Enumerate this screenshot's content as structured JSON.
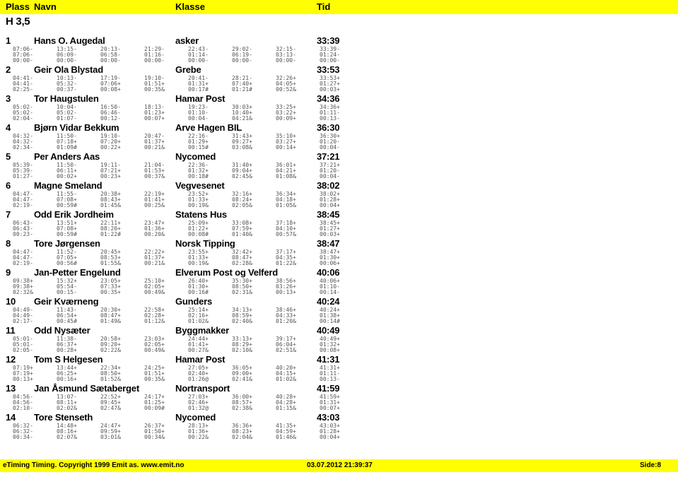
{
  "header": {
    "plass": "Plass",
    "navn": "Navn",
    "klasse": "Klasse",
    "tid": "Tid"
  },
  "class_title": "H 3,5",
  "results": [
    {
      "plass": "1",
      "navn": "Hans O. Augedal",
      "klasse": "asker",
      "tid": "33:39",
      "cumulative": [
        "07:06-",
        "13:15-",
        "20:13-",
        "21:29-",
        "22:43-",
        "29:02-",
        "32:15-",
        "33:39-"
      ],
      "legs": [
        "07:06-",
        "06:09-",
        "06:58-",
        "01:16-",
        "01:14-",
        "06:19-",
        "03:13-",
        "01:24-"
      ],
      "diffs": [
        "00:00-",
        "00:00-",
        "00:00-",
        "00:00-",
        "00:00-",
        "00:00-",
        "00:00-",
        "00:00-"
      ]
    },
    {
      "plass": "2",
      "navn": "Geir Ola Blystad",
      "klasse": "Grebe",
      "tid": "33:53",
      "cumulative": [
        "04:41-",
        "10:13-",
        "17:19-",
        "19:10-",
        "20:41-",
        "28:21-",
        "32:26+",
        "33:53+"
      ],
      "legs": [
        "04:41-",
        "05:32-",
        "07:06+",
        "01:51+",
        "01:31+",
        "07:40+",
        "04:05+",
        "01:27+"
      ],
      "diffs": [
        "02:25-",
        "00:37-",
        "00:08+",
        "00:35&",
        "00:17#",
        "01:21#",
        "00:52&",
        "00:03+"
      ]
    },
    {
      "plass": "3",
      "navn": "Tor Haugstulen",
      "klasse": "Hamar Post",
      "tid": "34:36",
      "cumulative": [
        "05:02-",
        "10:04-",
        "16:50-",
        "18:13-",
        "19:23-",
        "30:03+",
        "33:25+",
        "34:36+"
      ],
      "legs": [
        "05:02-",
        "05:02-",
        "06:46-",
        "01:23+",
        "01:10-",
        "10:40+",
        "03:22+",
        "01:11-"
      ],
      "diffs": [
        "02:04-",
        "01:07-",
        "00:12-",
        "00:07+",
        "00:04-",
        "04:21&",
        "00:09+",
        "00:13-"
      ]
    },
    {
      "plass": "4",
      "navn": "Bjørn Vidar Bekkum",
      "klasse": "Arve Hagen BIL",
      "tid": "36:30",
      "cumulative": [
        "04:32-",
        "11:50-",
        "19:10-",
        "20:47-",
        "22:16-",
        "31:43+",
        "35:10+",
        "36:30+"
      ],
      "legs": [
        "04:32-",
        "07:18+",
        "07:20+",
        "01:37+",
        "01:29+",
        "09:27+",
        "03:27+",
        "01:20-"
      ],
      "diffs": [
        "02:34-",
        "01:09#",
        "00:22+",
        "00:21&",
        "00:15#",
        "03:08&",
        "00:14+",
        "00:04-"
      ]
    },
    {
      "plass": "5",
      "navn": "Per Anders Aas",
      "klasse": "Nycomed",
      "tid": "37:21",
      "cumulative": [
        "05:39-",
        "11:50-",
        "19:11-",
        "21:04-",
        "22:36-",
        "31:40+",
        "36:01+",
        "37:21+"
      ],
      "legs": [
        "05:39-",
        "06:11+",
        "07:21+",
        "01:53+",
        "01:32+",
        "09:04+",
        "04:21+",
        "01:20-"
      ],
      "diffs": [
        "01:27-",
        "00:02+",
        "00:23+",
        "00:37&",
        "00:18#",
        "02:45&",
        "01:08&",
        "00:04-"
      ]
    },
    {
      "plass": "6",
      "navn": "Magne Smeland",
      "klasse": "Vegvesenet",
      "tid": "38:02",
      "cumulative": [
        "04:47-",
        "11:55-",
        "20:38+",
        "22:19+",
        "23:52+",
        "32:16+",
        "36:34+",
        "38:02+"
      ],
      "legs": [
        "04:47-",
        "07:08+",
        "08:43+",
        "01:41+",
        "01:33+",
        "08:24+",
        "04:18+",
        "01:28+"
      ],
      "diffs": [
        "02:19-",
        "00:59#",
        "01:45&",
        "00:25&",
        "00:19&",
        "02:05&",
        "01:05&",
        "00:04+"
      ]
    },
    {
      "plass": "7",
      "navn": "Odd Erik Jordheim",
      "klasse": "Statens Hus",
      "tid": "38:45",
      "cumulative": [
        "06:43-",
        "13:51+",
        "22:11+",
        "23:47+",
        "25:09+",
        "33:08+",
        "37:18+",
        "38:45+"
      ],
      "legs": [
        "06:43-",
        "07:08+",
        "08:20+",
        "01:36+",
        "01:22+",
        "07:59+",
        "04:10+",
        "01:27+"
      ],
      "diffs": [
        "00:23-",
        "00:59#",
        "01:22#",
        "00:20&",
        "00:08#",
        "01:40&",
        "00:57&",
        "00:03+"
      ]
    },
    {
      "plass": "8",
      "navn": "Tore  Jørgensen",
      "klasse": "Norsk Tipping",
      "tid": "38:47",
      "cumulative": [
        "04:47-",
        "11:52-",
        "20:45+",
        "22:22+",
        "23:55+",
        "32:42+",
        "37:17+",
        "38:47+"
      ],
      "legs": [
        "04:47-",
        "07:05+",
        "08:53+",
        "01:37+",
        "01:33+",
        "08:47+",
        "04:35+",
        "01:30+"
      ],
      "diffs": [
        "02:19-",
        "00:56#",
        "01:55&",
        "00:21&",
        "00:19&",
        "02:28&",
        "01:22&",
        "00:06+"
      ]
    },
    {
      "plass": "9",
      "navn": "Jan-Petter Engelund",
      "klasse": "Elverum Post og Velferd",
      "tid": "40:06",
      "cumulative": [
        "09:38+",
        "15:32+",
        "23:05+",
        "25:10+",
        "26:40+",
        "35:30+",
        "38:56+",
        "40:06+"
      ],
      "legs": [
        "09:38+",
        "05:54-",
        "07:33+",
        "02:05+",
        "01:30+",
        "08:50+",
        "03:26+",
        "01:10-"
      ],
      "diffs": [
        "02:32&",
        "00:15-",
        "00:35+",
        "00:49&",
        "00:16#",
        "02:31&",
        "00:13+",
        "00:14-"
      ]
    },
    {
      "plass": "10",
      "navn": "Geir Kværneng",
      "klasse": "Gunders",
      "tid": "40:24",
      "cumulative": [
        "04:49-",
        "11:43-",
        "20:30+",
        "22:58+",
        "25:14+",
        "34:13+",
        "38:46+",
        "40:24+"
      ],
      "legs": [
        "04:49-",
        "06:54+",
        "08:47+",
        "02:28+",
        "02:16+",
        "08:59+",
        "04:33+",
        "01:38+"
      ],
      "diffs": [
        "02:17-",
        "00:45#",
        "01:49&",
        "01:12&",
        "01:02&",
        "02:40&",
        "01:20&",
        "00:14#"
      ]
    },
    {
      "plass": "11",
      "navn": "Odd Nysæter",
      "klasse": "Byggmakker",
      "tid": "40:49",
      "cumulative": [
        "05:01-",
        "11:38-",
        "20:58+",
        "23:03+",
        "24:44+",
        "33:13+",
        "39:17+",
        "40:49+"
      ],
      "legs": [
        "05:01-",
        "06:37+",
        "09:20+",
        "02:05+",
        "01:41+",
        "08:29+",
        "06:04+",
        "01:32+"
      ],
      "diffs": [
        "02:05-",
        "00:28+",
        "02:22&",
        "00:49&",
        "00:27&",
        "02:10&",
        "02:51&",
        "00:08+"
      ]
    },
    {
      "plass": "12",
      "navn": "Tom S Helgesen",
      "klasse": "Hamar Post",
      "tid": "41:31",
      "cumulative": [
        "07:19+",
        "13:44+",
        "22:34+",
        "24:25+",
        "27:05+",
        "36:05+",
        "40:20+",
        "41:31+"
      ],
      "legs": [
        "07:19+",
        "06:25+",
        "08:50+",
        "01:51+",
        "02:40+",
        "09:00+",
        "04:15+",
        "01:11-"
      ],
      "diffs": [
        "00:13+",
        "00:16+",
        "01:52&",
        "00:35&",
        "01:26@",
        "02:41&",
        "01:02&",
        "00:13-"
      ]
    },
    {
      "plass": "13",
      "navn": "Jan Åsmund Sætaberget",
      "klasse": "Nortransport",
      "tid": "41:59",
      "cumulative": [
        "04:56-",
        "13:07-",
        "22:52+",
        "24:17+",
        "27:03+",
        "36:00+",
        "40:28+",
        "41:59+"
      ],
      "legs": [
        "04:56-",
        "08:11+",
        "09:45+",
        "01:25+",
        "02:46+",
        "08:57+",
        "04:28+",
        "01:31+"
      ],
      "diffs": [
        "02:10-",
        "02:02&",
        "02:47&",
        "00:09#",
        "01:32@",
        "02:38&",
        "01:15&",
        "00:07+"
      ]
    },
    {
      "plass": "14",
      "navn": "Tore Stenseth",
      "klasse": "Nycomed",
      "tid": "43:03",
      "cumulative": [
        "06:32-",
        "14:48+",
        "24:47+",
        "26:37+",
        "28:13+",
        "36:36+",
        "41:35+",
        "43:03+"
      ],
      "legs": [
        "06:32-",
        "08:16+",
        "09:59+",
        "01:50+",
        "01:36+",
        "08:23+",
        "04:59+",
        "01:28+"
      ],
      "diffs": [
        "00:34-",
        "02:07&",
        "03:01&",
        "00:34&",
        "00:22&",
        "02:04&",
        "01:46&",
        "00:04+"
      ]
    }
  ],
  "footer": {
    "copyright": "eTiming Timing. Copyright 1999 Emit as. www.emit.no",
    "datetime": "03.07.2012 21:39:37",
    "page": "Side:8"
  },
  "colors": {
    "bar": "#ffff00",
    "text": "#000000",
    "split_text": "#555555"
  }
}
